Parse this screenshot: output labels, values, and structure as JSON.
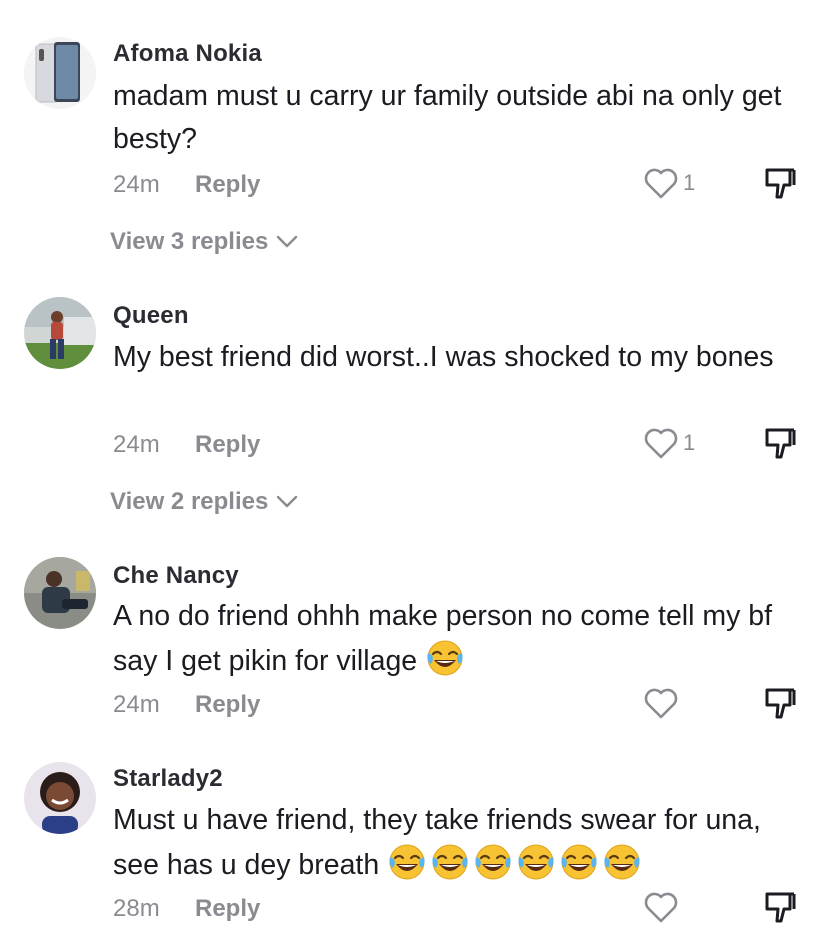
{
  "comments": [
    {
      "username": "Afoma Nokia",
      "text": "madam must u carry ur family outside abi na only get besty?",
      "time": "24m",
      "reply": "Reply",
      "likes": "1",
      "view_replies": "View 3 replies"
    },
    {
      "username": "Queen",
      "text": "My best friend did worst..I was shocked to my bones",
      "time": "24m",
      "reply": "Reply",
      "likes": "1",
      "view_replies": "View 2 replies"
    },
    {
      "username": "Che Nancy",
      "text": "A no do friend ohhh make person no come tell my bf say I get pikin for village",
      "time": "24m",
      "reply": "Reply",
      "emoji": "laughing-crying-emoji",
      "emoji_count": 1
    },
    {
      "username": "Starlady2",
      "text": "Must u have friend, they take friends swear for una, see has u dey breath",
      "time": "28m",
      "reply": "Reply",
      "emoji": "laughing-crying-emoji",
      "emoji_count": 6
    }
  ],
  "icons": {
    "like": "heart-icon",
    "dislike": "thumbs-down-icon",
    "expand": "chevron-down-icon"
  },
  "colors": {
    "text": "#1b1b22",
    "muted": "#8a8b91"
  }
}
